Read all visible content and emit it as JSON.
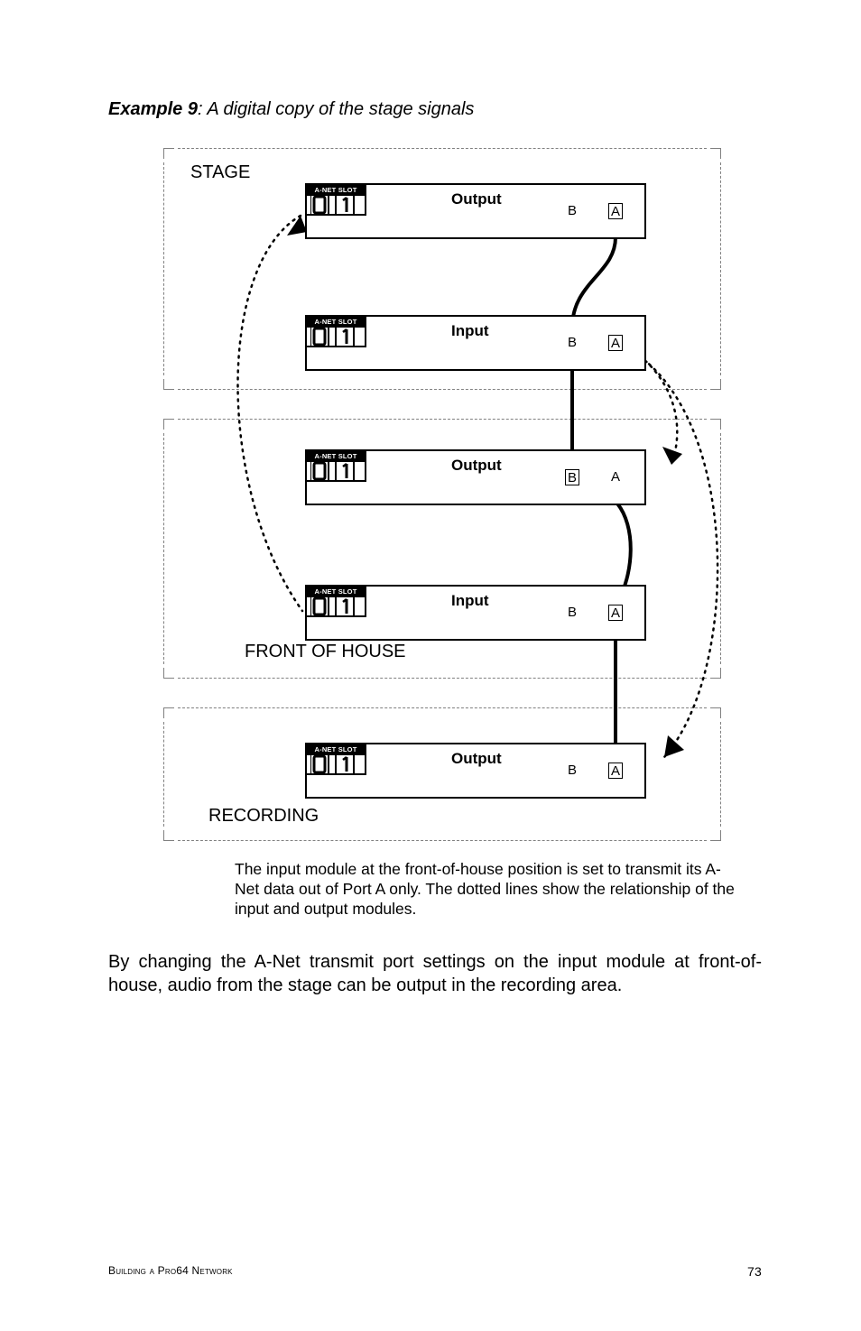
{
  "example": {
    "label": "Example 9",
    "subtitle": ":  A digital copy of the stage signals"
  },
  "zones": {
    "stage": "STAGE",
    "foh": "FRONT OF HOUSE",
    "rec": "RECORDING"
  },
  "anet": {
    "label": "A-NET SLOT"
  },
  "modules": {
    "m1": {
      "title": "Output",
      "seg": "0 1",
      "portB": "B",
      "portA": "A",
      "boxed": "A"
    },
    "m2": {
      "title": "Input",
      "seg": "0 1",
      "portB": "B",
      "portA": "A",
      "boxed": "A"
    },
    "m3": {
      "title": "Output",
      "seg": "0 1",
      "portB": "B",
      "portA": "A",
      "boxed": "B"
    },
    "m4": {
      "title": "Input",
      "seg": "0 1",
      "portB": "B",
      "portA": "A",
      "boxed": "A"
    },
    "m5": {
      "title": "Output",
      "seg": "0 1",
      "portB": "B",
      "portA": "A",
      "boxed": "A"
    }
  },
  "caption": "The input module at the front-of-house position is set to transmit its A-Net data out of Port A only. The dotted lines show the relationship of the input and output modules.",
  "body": "By changing the A-Net transmit port settings on the input module at front-of-house, audio from the stage can be output in the recording area.",
  "footer": {
    "left": "Building a Pro64 Network",
    "page": "73"
  }
}
